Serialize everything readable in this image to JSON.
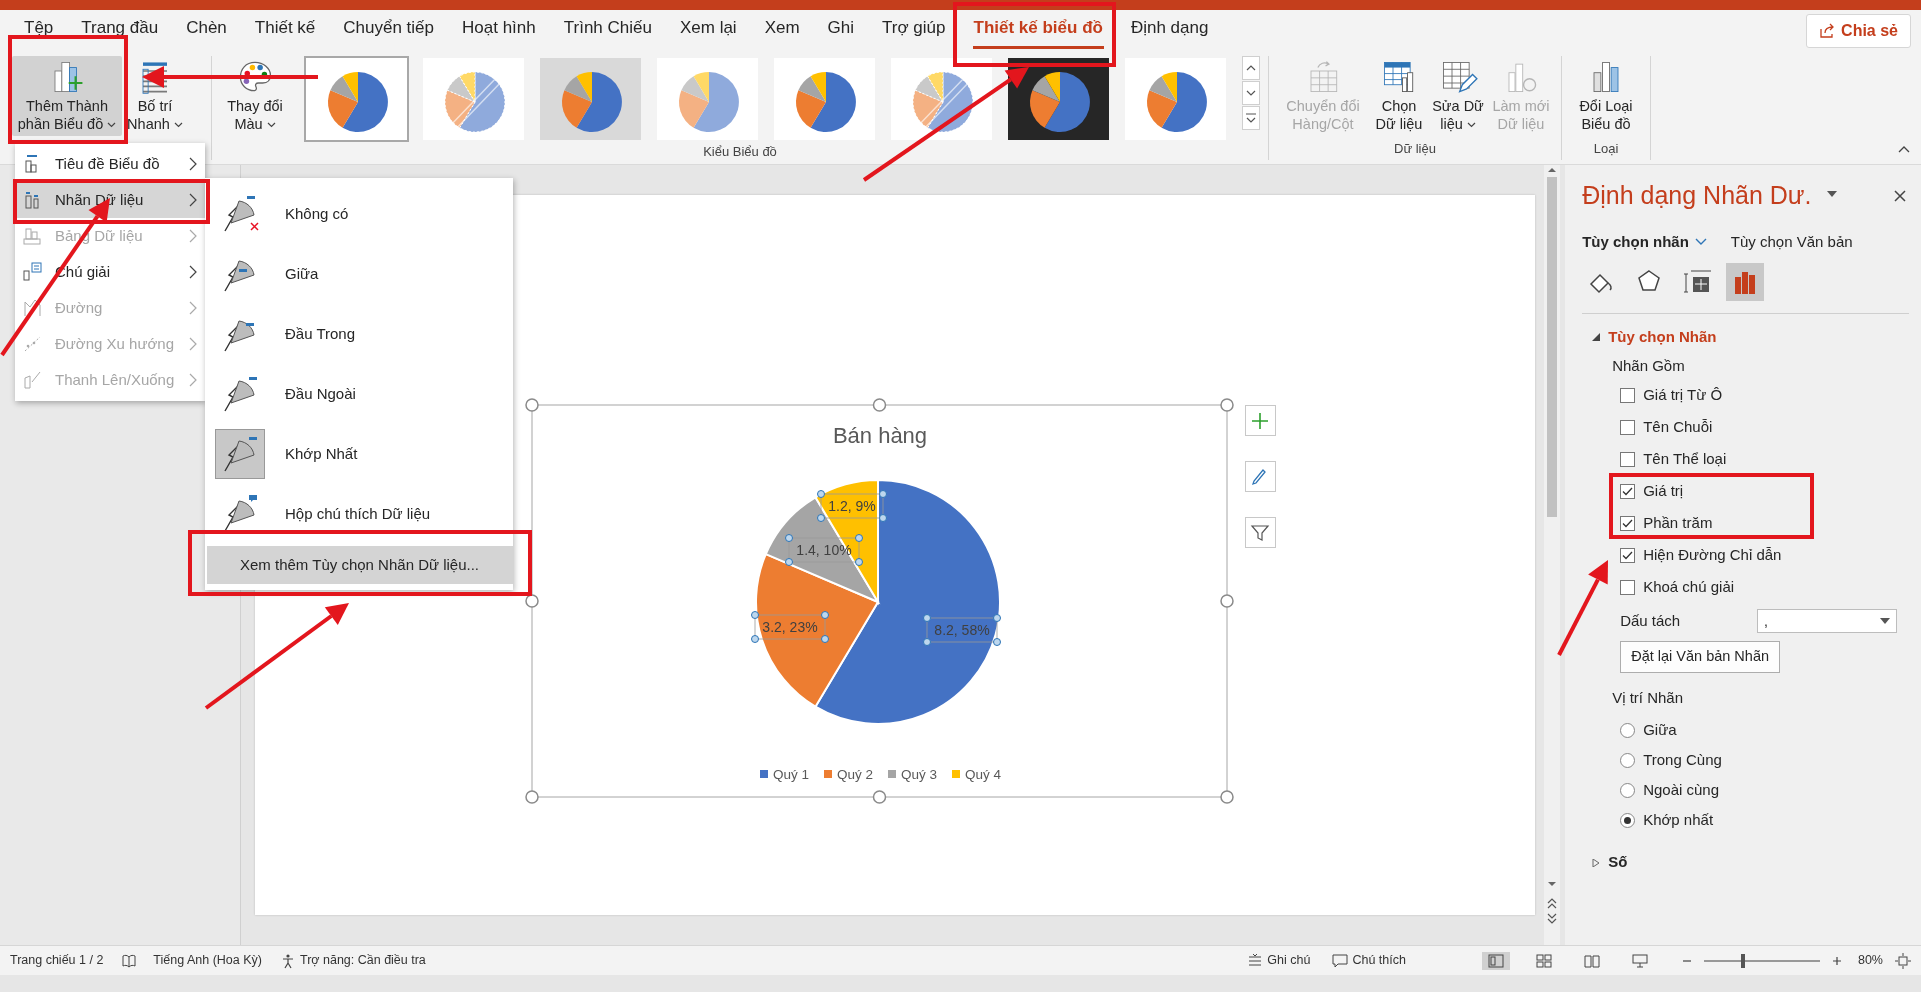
{
  "tabs": [
    {
      "label": "Tệp",
      "selected": false
    },
    {
      "label": "Trang đầu",
      "selected": false
    },
    {
      "label": "Chèn",
      "selected": false
    },
    {
      "label": "Thiết kế",
      "selected": false
    },
    {
      "label": "Chuyển tiếp",
      "selected": false
    },
    {
      "label": "Hoạt hình",
      "selected": false
    },
    {
      "label": "Trình Chiếu",
      "selected": false
    },
    {
      "label": "Xem lại",
      "selected": false
    },
    {
      "label": "Xem",
      "selected": false
    },
    {
      "label": "Ghi",
      "selected": false
    },
    {
      "label": "Trợ giúp",
      "selected": false
    },
    {
      "label": "Thiết kế biểu đồ",
      "selected": true
    },
    {
      "label": "Định dạng",
      "selected": false
    }
  ],
  "share_button": "Chia sẻ",
  "ribbon": {
    "groups": [
      {
        "buttons": [
          {
            "kind": "add_element",
            "label": "Thêm Thành phần Biểu đồ",
            "dropdown": true,
            "disabled": false,
            "selected": true
          },
          {
            "kind": "quick_layout",
            "label": "Bố trí Nhanh",
            "dropdown": true,
            "disabled": false,
            "selected": false
          }
        ]
      },
      {
        "label": "Kiểu Biểu đồ",
        "buttons": [
          {
            "kind": "colors",
            "label": "Thay đổi Màu",
            "dropdown": true,
            "disabled": false,
            "selected": false
          }
        ],
        "gallery": [
          {
            "kind": "plain",
            "selected": true
          },
          {
            "kind": "hatched",
            "selected": false
          },
          {
            "kind": "gray",
            "selected": false
          },
          {
            "kind": "pastel",
            "selected": false
          },
          {
            "kind": "plain",
            "selected": false
          },
          {
            "kind": "hatched",
            "selected": false
          },
          {
            "kind": "dark",
            "selected": false
          },
          {
            "kind": "plain",
            "selected": false
          }
        ]
      },
      {
        "label": "Dữ liệu",
        "buttons": [
          {
            "kind": "switch",
            "label": "Chuyển đổi Hàng/Cột",
            "dropdown": false,
            "disabled": true,
            "selected": false
          },
          {
            "kind": "select_data",
            "label": "Chọn Dữ liệu",
            "dropdown": false,
            "disabled": false,
            "selected": false
          },
          {
            "kind": "edit_data",
            "label": "Sửa Dữ liệu",
            "dropdown": true,
            "disabled": false,
            "selected": false
          },
          {
            "kind": "refresh",
            "label": "Làm mới Dữ liệu",
            "dropdown": false,
            "disabled": true,
            "selected": false
          }
        ]
      },
      {
        "label": "Loại",
        "buttons": [
          {
            "kind": "change_type",
            "label": "Đổi Loại Biểu đồ",
            "dropdown": false,
            "disabled": false,
            "selected": false
          }
        ]
      }
    ]
  },
  "element_menu": [
    {
      "label": "Tiêu đề Biểu đồ",
      "kind": "title",
      "disabled": false,
      "selected": false
    },
    {
      "label": "Nhãn Dữ liệu",
      "kind": "labels",
      "disabled": false,
      "selected": true
    },
    {
      "label": "Bảng Dữ liệu",
      "kind": "table",
      "disabled": true,
      "selected": false
    },
    {
      "label": "Chú giải",
      "kind": "legend",
      "disabled": false,
      "selected": false
    },
    {
      "label": "Đường",
      "kind": "lines",
      "disabled": true,
      "selected": false
    },
    {
      "label": "Đường Xu hướng",
      "kind": "trendline",
      "disabled": true,
      "selected": false
    },
    {
      "label": "Thanh Lên/Xuống",
      "kind": "updown",
      "disabled": true,
      "selected": false
    }
  ],
  "data_label_menu": {
    "items": [
      {
        "label": "Không có",
        "kind": "none",
        "selected": false
      },
      {
        "label": "Giữa",
        "kind": "center",
        "selected": false
      },
      {
        "label": "Đầu Trong",
        "kind": "inside_end",
        "selected": false
      },
      {
        "label": "Đầu Ngoài",
        "kind": "outside_end",
        "selected": false
      },
      {
        "label": "Khớp Nhất",
        "kind": "best_fit",
        "selected": true
      },
      {
        "label": "Hộp chú thích Dữ liệu",
        "kind": "callout",
        "selected": false
      }
    ],
    "more": {
      "label": "Xem thêm Tùy chọn Nhãn Dữ liệu...",
      "highlighted": true
    }
  },
  "chart": {
    "chart_data": {
      "type": "pie",
      "title": "Bán hàng",
      "categories": [
        "Quý 1",
        "Quý 2",
        "Quý 3",
        "Quý 4"
      ],
      "values": [
        8.2,
        3.2,
        1.4,
        1.2
      ],
      "colors": [
        "#4472c4",
        "#ed7d31",
        "#a5a5a5",
        "#ffc000"
      ],
      "value_labels": [
        "8.2, 58%",
        "3.2, 23%",
        "1.4, 10%",
        "1.2, 9%"
      ],
      "legend": "bottom"
    }
  },
  "format_panel": {
    "title": "Định dạng Nhãn Dư.",
    "tabs": [
      {
        "label": "Tùy chọn nhãn",
        "selected": true
      },
      {
        "label": "Tùy chọn Văn bản",
        "selected": false
      }
    ],
    "icon_tabs": [
      {
        "kind": "fill",
        "selected": false
      },
      {
        "kind": "effects",
        "selected": false
      },
      {
        "kind": "size",
        "selected": false
      },
      {
        "kind": "options",
        "selected": true
      }
    ],
    "section": {
      "title": "Tùy chọn Nhãn",
      "expanded": true
    },
    "contains_label": "Nhãn Gồm",
    "contains": [
      {
        "label": "Giá trị Từ Ô",
        "checked": false
      },
      {
        "label": "Tên Chuỗi",
        "checked": false
      },
      {
        "label": "Tên Thể loại",
        "checked": false
      },
      {
        "label": "Giá trị",
        "checked": true
      },
      {
        "label": "Phần trăm",
        "checked": true
      },
      {
        "label": "Hiện Đường Chỉ dẫn",
        "checked": true
      },
      {
        "label": "Khoá chú giải",
        "checked": false
      }
    ],
    "separator": {
      "label": "Dấu tách",
      "value": ","
    },
    "reset_button": "Đặt lại Văn bản Nhãn",
    "position_label": "Vị trí Nhãn",
    "positions": [
      {
        "label": "Giữa",
        "selected": false
      },
      {
        "label": "Trong Cùng",
        "selected": false
      },
      {
        "label": "Ngoài cùng",
        "selected": false
      },
      {
        "label": "Khớp nhất",
        "selected": true
      }
    ],
    "number_section": {
      "title": "Số",
      "expanded": false
    }
  },
  "status_bar": {
    "slide": "Trang chiếu 1 / 2",
    "language": "Tiếng Anh (Hoa Kỳ)",
    "accessibility": "Trợ năng: Cần điều tra",
    "notes": "Ghi chú",
    "comments": "Chú thích",
    "views": [
      {
        "kind": "normal",
        "selected": true
      },
      {
        "kind": "sorter",
        "selected": false
      },
      {
        "kind": "reading",
        "selected": false
      },
      {
        "kind": "show",
        "selected": false
      }
    ],
    "zoom": {
      "level": 0.34,
      "reading": "80%"
    }
  }
}
